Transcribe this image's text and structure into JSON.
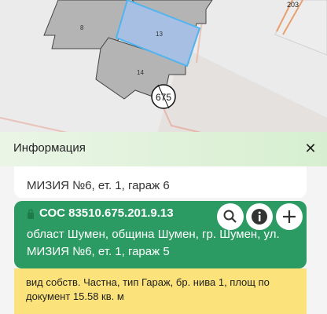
{
  "map": {
    "parcel_labels": {
      "p8": "8",
      "p13": "13",
      "p14": "14",
      "p203": "203"
    },
    "building_number": "675",
    "colors": {
      "building": "#b4b4b4",
      "selected": "#a8bfe4",
      "selected_border": "#4fb4ef",
      "boundary": "#e89a8a"
    }
  },
  "panel": {
    "title": "Информация",
    "close_icon": "close-icon",
    "prev_card": {
      "cut_text": "...",
      "line2": "МИЗИЯ №6, ет. 1, гараж 6"
    },
    "card": {
      "id": "СОС 83510.675.201.9.13",
      "addr_line1": "област Шумен, община Шумен, гр. Шумен, ул.",
      "addr_line2": "МИЗИЯ №6, ет. 1, гараж 5",
      "actions": [
        "search-icon",
        "info-icon",
        "add-icon"
      ],
      "bg": "#2c9a63"
    },
    "details": {
      "line1": "вид собств. Частна, тип Гараж, бр. нива 1, площ по",
      "line2": "документ 15.58 кв. м",
      "bg": "#fbe27a"
    }
  }
}
